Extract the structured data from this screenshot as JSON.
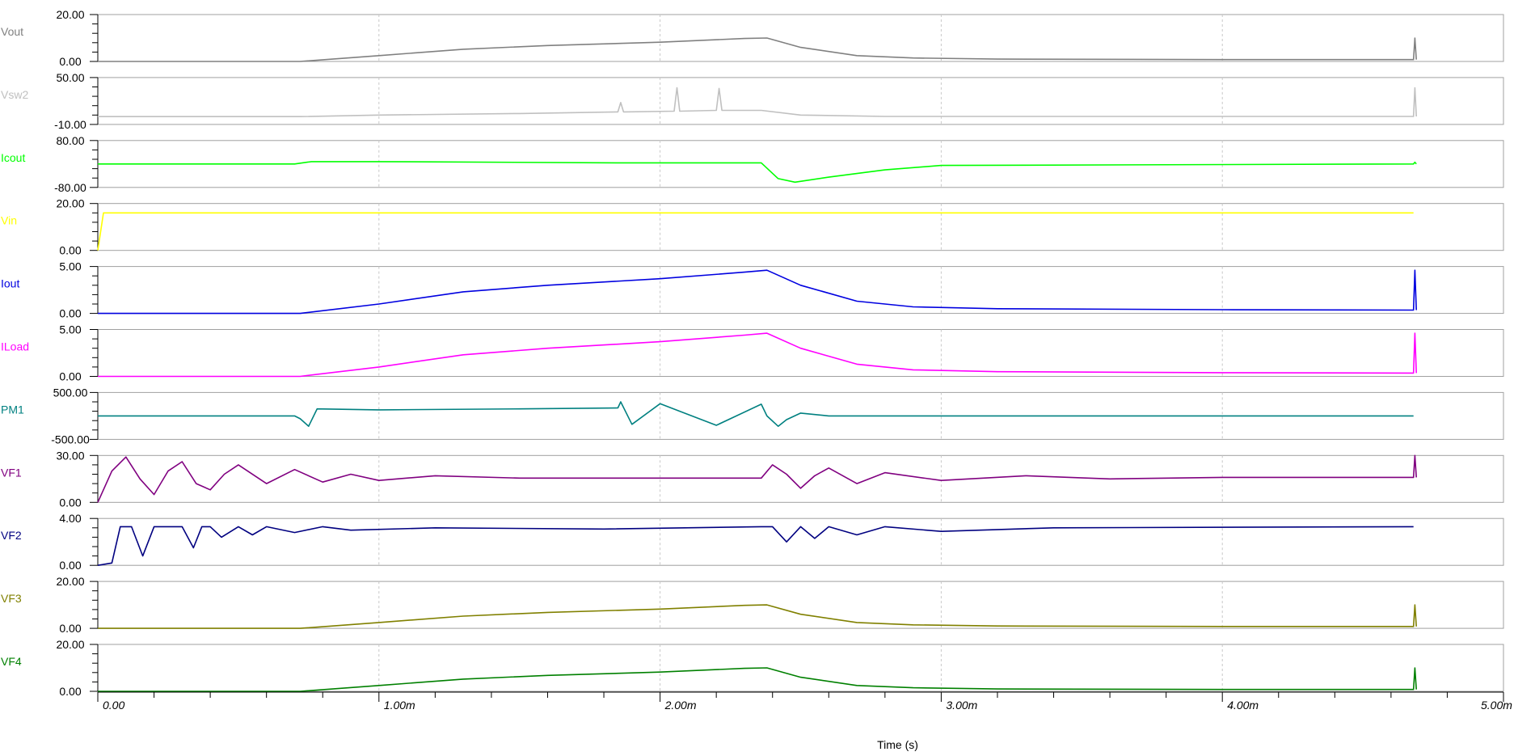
{
  "chart_data": {
    "type": "line",
    "xlabel": "Time (s)",
    "xlim": [
      0,
      5.0
    ],
    "x_unit": "ms",
    "x_tick_values": [
      0,
      1,
      2,
      3,
      4,
      5
    ],
    "x_tick_labels": [
      "0.00",
      "1.00m",
      "2.00m",
      "3.00m",
      "4.00m",
      "5.00m"
    ],
    "grid": "vertical-dashed",
    "series": [
      {
        "name": "Vout",
        "color": "#808080",
        "ylim": [
          0,
          20
        ],
        "ytick_labels": [
          "20.00",
          "0.00"
        ],
        "x": [
          0,
          0.72,
          1.0,
          1.3,
          1.6,
          2.0,
          2.3,
          2.38,
          2.5,
          2.7,
          2.9,
          3.2,
          4.0,
          4.68,
          4.685,
          4.69
        ],
        "y": [
          0,
          0,
          2.5,
          5.2,
          6.8,
          8.2,
          9.8,
          10.0,
          6.0,
          2.5,
          1.5,
          1.0,
          0.8,
          0.8,
          10.0,
          0.8
        ]
      },
      {
        "name": "Vsw2",
        "color": "#c0c0c0",
        "ylim": [
          -10,
          50
        ],
        "ytick_labels": [
          "50.00",
          "-10.00"
        ],
        "x": [
          0,
          0.72,
          1.0,
          1.5,
          1.85,
          1.86,
          1.87,
          2.05,
          2.06,
          2.07,
          2.2,
          2.21,
          2.22,
          2.36,
          2.5,
          2.8,
          4.68,
          4.685,
          4.69
        ],
        "y": [
          0,
          0,
          2.0,
          4.0,
          6.0,
          18.0,
          6.0,
          7.0,
          37.0,
          7.0,
          8.0,
          36.0,
          8.0,
          8.0,
          2.0,
          0.2,
          0.2,
          37.0,
          0.2
        ]
      },
      {
        "name": "Icout",
        "color": "#00ff00",
        "ylim": [
          -80,
          80
        ],
        "ytick_labels": [
          "80.00",
          "-80.00"
        ],
        "x": [
          0,
          0.7,
          0.76,
          1.0,
          1.85,
          2.36,
          2.42,
          2.48,
          2.6,
          2.8,
          3.0,
          4.68,
          4.685,
          4.69
        ],
        "y": [
          0,
          0,
          8.0,
          8.0,
          4.0,
          4.0,
          -50.0,
          -62.0,
          -45.0,
          -20.0,
          -5.0,
          0,
          6.0,
          0
        ]
      },
      {
        "name": "Vin",
        "color": "#ffff00",
        "ylim": [
          0,
          20
        ],
        "ytick_labels": [
          "20.00",
          "0.00"
        ],
        "x": [
          0,
          0.02,
          0.05,
          4.68
        ],
        "y": [
          0,
          16.0,
          16.0,
          16.0
        ]
      },
      {
        "name": "Iout",
        "color": "#0000e0",
        "ylim": [
          0,
          5
        ],
        "ytick_labels": [
          "5.00",
          "0.00"
        ],
        "x": [
          0,
          0.72,
          1.0,
          1.3,
          1.6,
          2.0,
          2.3,
          2.38,
          2.5,
          2.7,
          2.9,
          3.2,
          4.0,
          4.68,
          4.685,
          4.69
        ],
        "y": [
          0,
          0,
          1.0,
          2.3,
          3.0,
          3.7,
          4.4,
          4.6,
          3.0,
          1.3,
          0.7,
          0.5,
          0.4,
          0.35,
          4.6,
          0.35
        ]
      },
      {
        "name": "ILoad",
        "color": "#ff00ff",
        "ylim": [
          0,
          5
        ],
        "ytick_labels": [
          "5.00",
          "0.00"
        ],
        "x": [
          0,
          0.72,
          1.0,
          1.3,
          1.6,
          2.0,
          2.3,
          2.38,
          2.5,
          2.7,
          2.9,
          3.2,
          4.0,
          4.68,
          4.685,
          4.69
        ],
        "y": [
          0,
          0,
          1.0,
          2.3,
          3.0,
          3.7,
          4.4,
          4.6,
          3.0,
          1.3,
          0.7,
          0.5,
          0.4,
          0.35,
          4.6,
          0.35
        ]
      },
      {
        "name": "PM1",
        "color": "#008080",
        "ylim": [
          -500,
          500
        ],
        "ytick_labels": [
          "500.00",
          "-500.00"
        ],
        "x": [
          0,
          0.7,
          0.72,
          0.75,
          0.78,
          1.0,
          1.5,
          1.85,
          1.86,
          1.9,
          2.0,
          2.2,
          2.36,
          2.38,
          2.42,
          2.45,
          2.5,
          2.6,
          4.68
        ],
        "y": [
          0,
          0,
          -60,
          -220,
          150,
          130,
          150,
          170,
          300,
          -180,
          260,
          -200,
          250,
          0,
          -220,
          -80,
          60,
          0,
          0
        ]
      },
      {
        "name": "VF1",
        "color": "#800080",
        "ylim": [
          0,
          30
        ],
        "ytick_labels": [
          "30.00",
          "0.00"
        ],
        "x": [
          0,
          0.05,
          0.1,
          0.15,
          0.2,
          0.25,
          0.3,
          0.35,
          0.4,
          0.45,
          0.5,
          0.6,
          0.7,
          0.8,
          0.9,
          1.0,
          1.2,
          1.5,
          2.0,
          2.36,
          2.4,
          2.45,
          2.5,
          2.55,
          2.6,
          2.7,
          2.8,
          3.0,
          3.3,
          3.6,
          4.0,
          4.68,
          4.685,
          4.69
        ],
        "y": [
          0,
          20.0,
          29.0,
          15.0,
          5.0,
          20.0,
          26.0,
          12.0,
          8.0,
          18.0,
          24.0,
          12.0,
          21.0,
          13.0,
          18.0,
          14.0,
          17.0,
          15.5,
          15.5,
          15.5,
          24.0,
          18.0,
          9.0,
          17.0,
          22.0,
          12.0,
          19.0,
          14.0,
          17.0,
          15.0,
          16.0,
          16.0,
          30.0,
          16.0
        ]
      },
      {
        "name": "VF2",
        "color": "#000080",
        "ylim": [
          0,
          4
        ],
        "ytick_labels": [
          "4.00",
          "0.00"
        ],
        "x": [
          0,
          0.05,
          0.08,
          0.12,
          0.16,
          0.2,
          0.24,
          0.3,
          0.34,
          0.37,
          0.4,
          0.44,
          0.5,
          0.55,
          0.6,
          0.7,
          0.8,
          0.9,
          1.2,
          1.8,
          2.36,
          2.4,
          2.45,
          2.5,
          2.55,
          2.6,
          2.7,
          2.8,
          3.0,
          3.4,
          4.68
        ],
        "y": [
          0,
          0.2,
          3.3,
          3.3,
          0.8,
          3.3,
          3.3,
          3.3,
          1.5,
          3.3,
          3.3,
          2.4,
          3.3,
          2.6,
          3.3,
          2.8,
          3.3,
          3.0,
          3.2,
          3.1,
          3.3,
          3.3,
          2.0,
          3.3,
          2.3,
          3.3,
          2.6,
          3.3,
          2.9,
          3.2,
          3.3
        ]
      },
      {
        "name": "VF3",
        "color": "#808000",
        "ylim": [
          0,
          20
        ],
        "ytick_labels": [
          "20.00",
          "0.00"
        ],
        "x": [
          0,
          0.72,
          1.0,
          1.3,
          1.6,
          2.0,
          2.3,
          2.38,
          2.5,
          2.7,
          2.9,
          3.2,
          4.0,
          4.68,
          4.685,
          4.69
        ],
        "y": [
          0,
          0,
          2.5,
          5.2,
          6.8,
          8.2,
          9.8,
          10.0,
          6.0,
          2.5,
          1.5,
          1.0,
          0.8,
          0.8,
          10.0,
          0.8
        ]
      },
      {
        "name": "VF4",
        "color": "#008000",
        "ylim": [
          0,
          20
        ],
        "ytick_labels": [
          "20.00",
          "0.00"
        ],
        "x": [
          0,
          0.72,
          1.0,
          1.3,
          1.6,
          2.0,
          2.3,
          2.38,
          2.5,
          2.7,
          2.9,
          3.2,
          4.0,
          4.68,
          4.685,
          4.69
        ],
        "y": [
          0,
          0,
          2.5,
          5.2,
          6.8,
          8.2,
          9.8,
          10.0,
          6.0,
          2.5,
          1.5,
          1.0,
          0.8,
          0.8,
          10.0,
          0.8
        ]
      }
    ]
  }
}
